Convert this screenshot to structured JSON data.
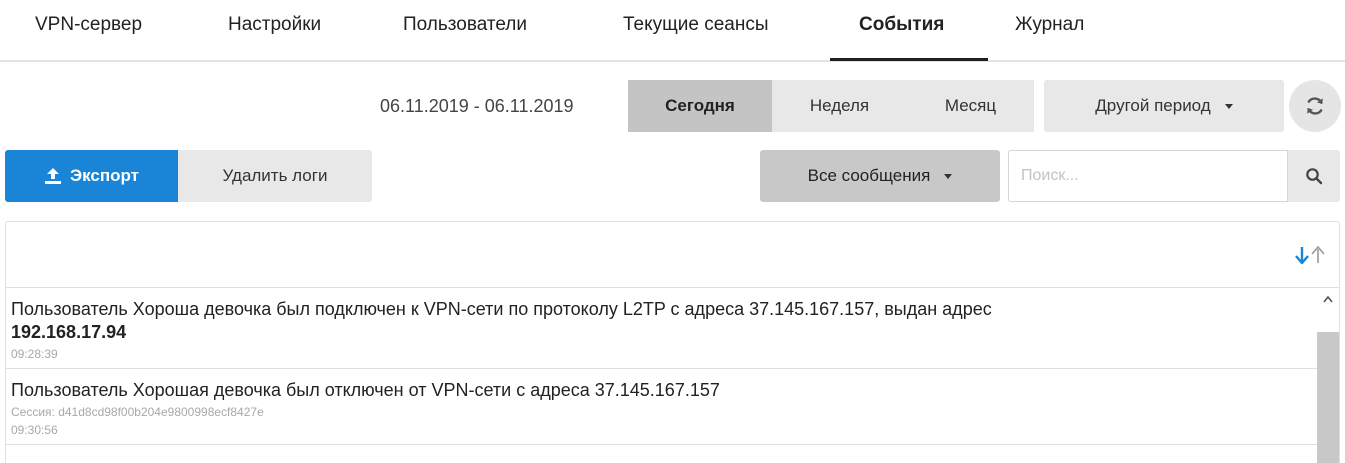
{
  "tabs": [
    {
      "label": "VPN-сервер",
      "active": false
    },
    {
      "label": "Настройки",
      "active": false
    },
    {
      "label": "Пользователи",
      "active": false
    },
    {
      "label": "Текущие сеансы",
      "active": false
    },
    {
      "label": "События",
      "active": true
    },
    {
      "label": "Журнал",
      "active": false
    }
  ],
  "period": {
    "date_range": "06.11.2019 - 06.11.2019",
    "today": "Сегодня",
    "week": "Неделя",
    "month": "Месяц",
    "other": "Другой период",
    "selected": "Сегодня",
    "refresh_icon": "refresh-icon"
  },
  "actions": {
    "export_label": "Экспорт",
    "export_icon": "upload-icon",
    "delete_label": "Удалить логи",
    "filter_label": "Все сообщения",
    "search_placeholder": "Поиск...",
    "search_value": "",
    "search_icon": "search-icon"
  },
  "sort": {
    "down_icon": "arrow-down-icon",
    "up_icon": "arrow-up-icon"
  },
  "log": {
    "entries": [
      {
        "text": "Пользователь Хороша девочка был подключен к VPN-сети по протоколу L2TP с адреса 37.145.167.157, выдан адрес",
        "bold": "192.168.17.94",
        "time": "09:28:39"
      },
      {
        "text": "Пользователь Хорошая девочка был отключен от VPN-сети с адреса 37.145.167.157",
        "session": "Сессия: d41d8cd98f00b204e9800998ecf8427e",
        "time": "09:30:56"
      }
    ]
  },
  "colors": {
    "accent": "#1a85d6",
    "selected_segment": "#c4c4c4",
    "button_bg": "#e8e8e8",
    "sort_active": "#1a85d6",
    "sort_inactive": "#9a9a9a"
  }
}
